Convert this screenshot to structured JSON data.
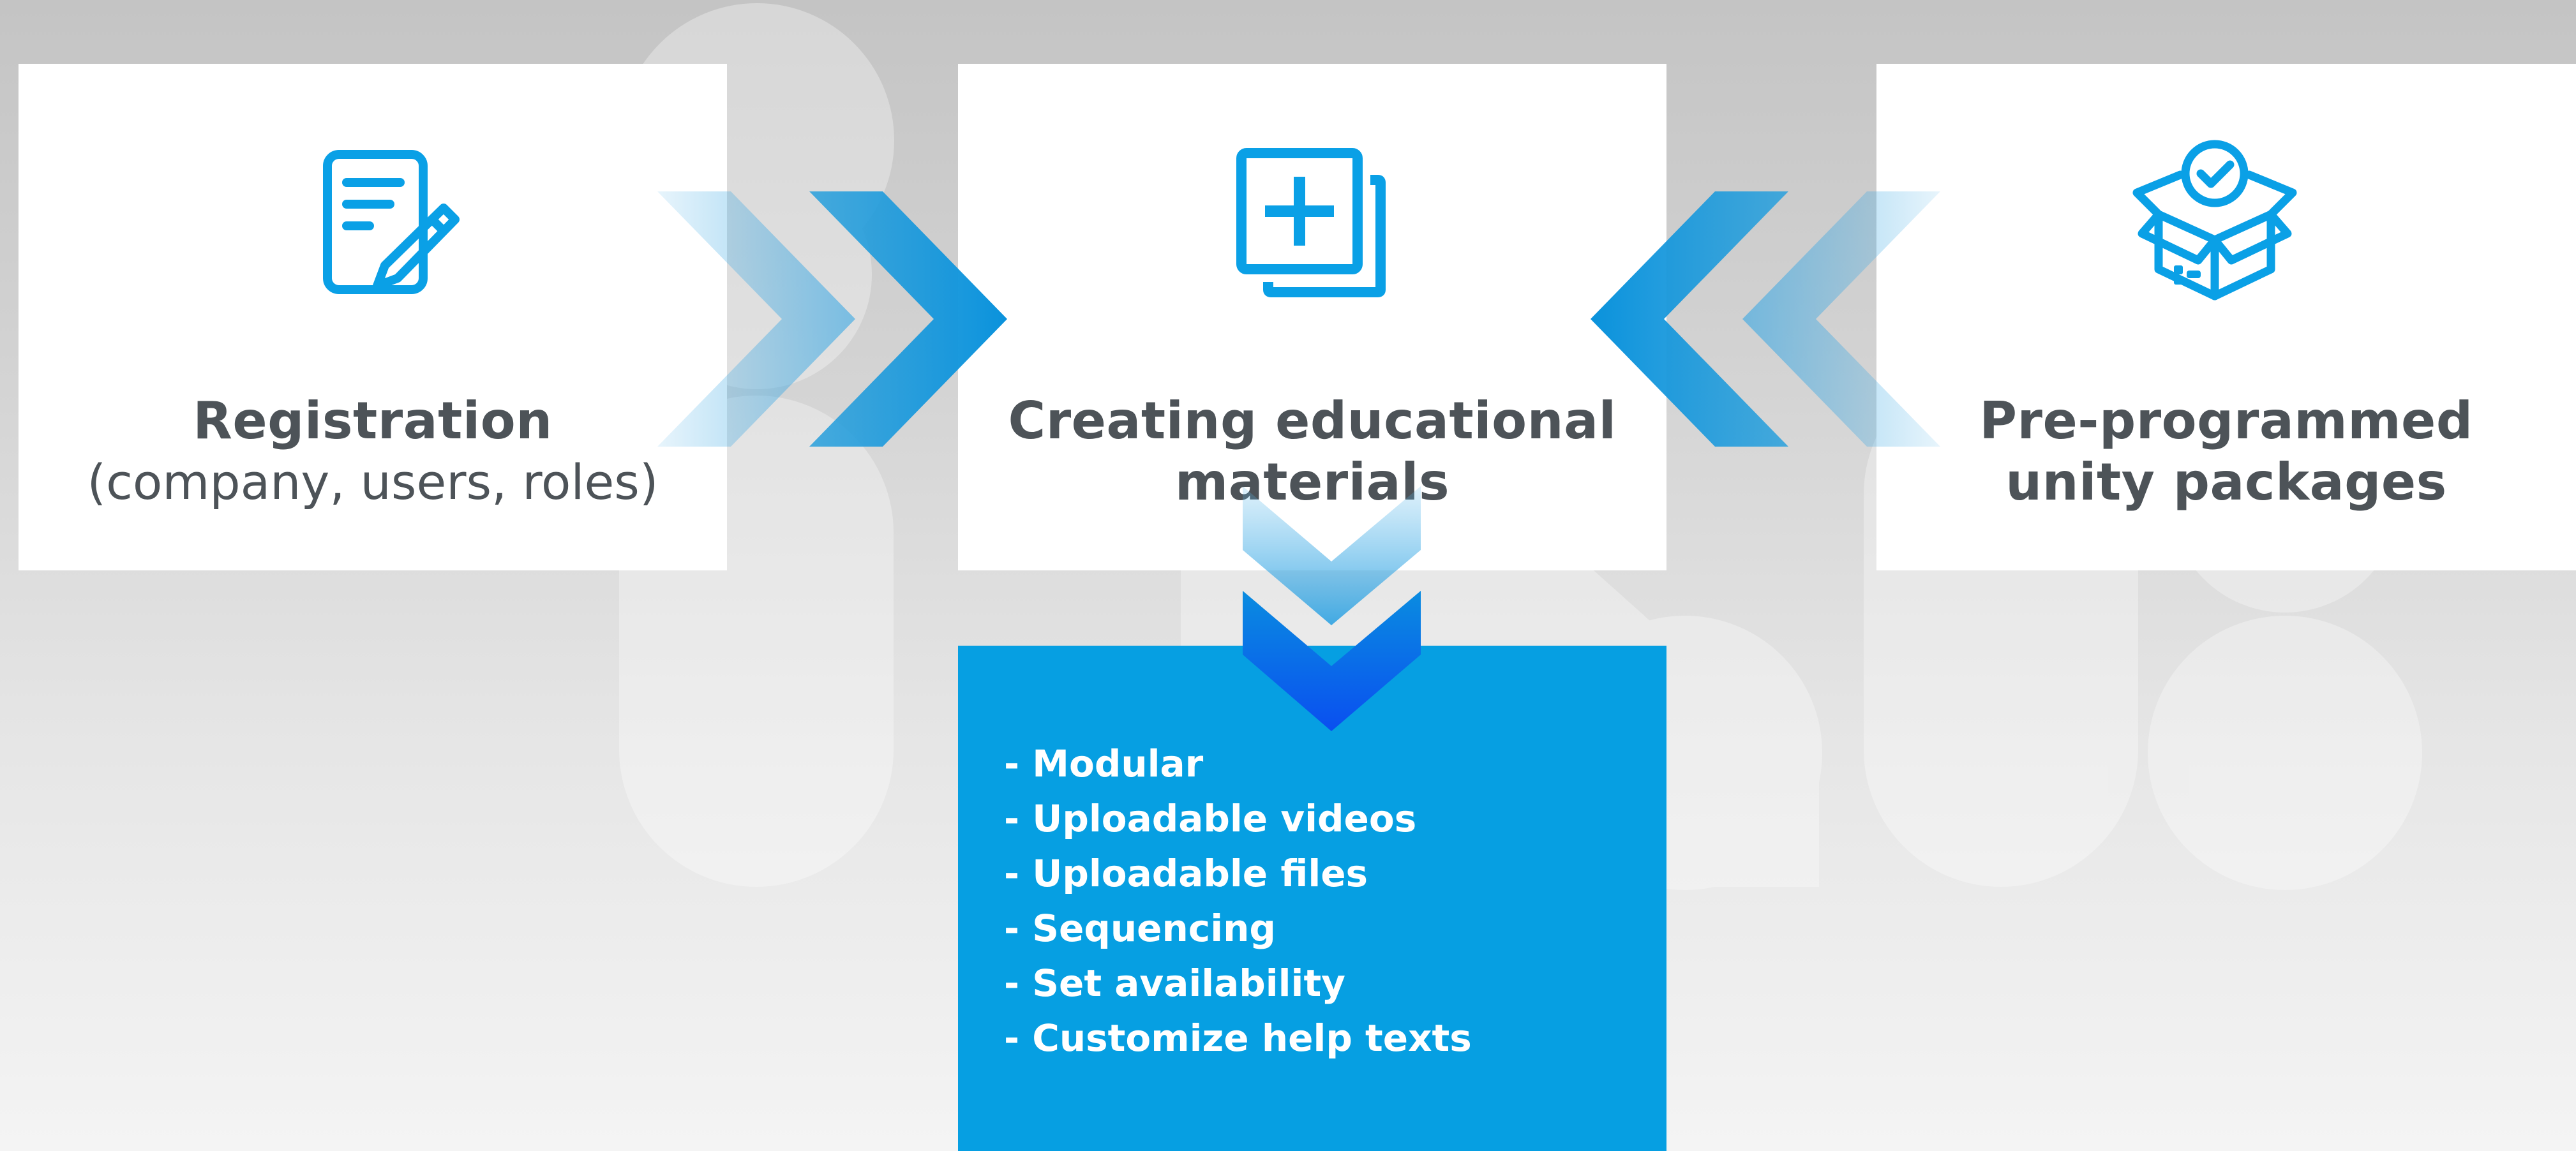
{
  "colors": {
    "accent": "#069fe2",
    "icon": "#0aa0e6",
    "title_text": "#4d5358",
    "card_background": "#ffffff",
    "feature_text": "#ffffff"
  },
  "cards": [
    {
      "id": "registration",
      "icon": "document-pen-icon",
      "title": "Registration",
      "subtitle": "(company, users, roles)"
    },
    {
      "id": "creating",
      "icon": "add-copy-icon",
      "title_line1": "Creating educational",
      "title_line2": "materials"
    },
    {
      "id": "packages",
      "icon": "open-box-check-icon",
      "title_line1": "Pre-programmed",
      "title_line2": "unity packages"
    }
  ],
  "features": [
    "- Modular",
    "- Uploadable videos",
    "- Uploadable files",
    "- Sequencing",
    "- Set availability",
    "- Customize help texts"
  ],
  "connectors": [
    {
      "icon": "double-chevron-right-icon",
      "from": "Registration",
      "to": "Creating educational materials"
    },
    {
      "icon": "double-chevron-left-icon",
      "from": "Pre-programmed unity packages",
      "to": "Creating educational materials"
    },
    {
      "icon": "double-chevron-down-icon",
      "from": "Creating educational materials",
      "to": "features"
    }
  ]
}
